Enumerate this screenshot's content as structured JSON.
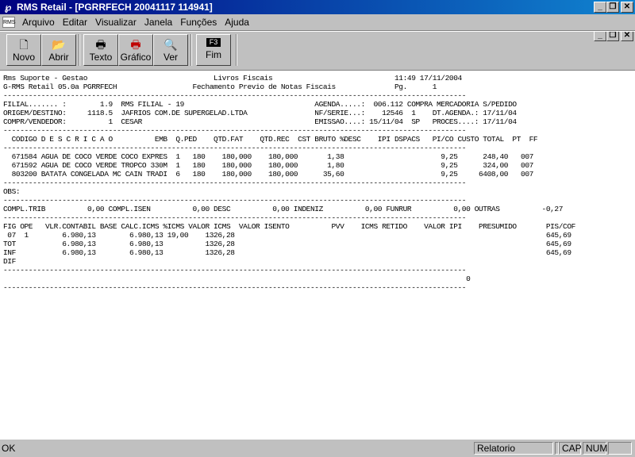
{
  "window": {
    "title": "RMS Retail - [PGRRFECH 20041117 114941]"
  },
  "menu": {
    "items": [
      "Arquivo",
      "Editar",
      "Visualizar",
      "Janela",
      "Funções",
      "Ajuda"
    ]
  },
  "toolbar": {
    "novo": "Novo",
    "abrir": "Abrir",
    "texto": "Texto",
    "grafico": "Gráfico",
    "ver": "Ver",
    "fim_key": "F3",
    "fim": "Fim"
  },
  "report": {
    "lines": [
      "Rms Suporte - Gestao                              Livros Fiscais                             11:49 17/11/2004",
      "G-RMS Retail 05.0a PGRRFECH                  Fechamento Previo de Notas Fiscais              Pg.      1",
      "--------------------------------------------------------------------------------------------------------------",
      "FILIAL....... :        1.9  RMS FILIAL - 19                               AGENDA.....:  006.112 COMPRA MERCADORIA S/PEDIDO",
      "ORIGEM/DESTINO:     1118.5  JAFRIOS COM.DE SUPERGELAD.LTDA                NF/SERIE...:    12546  1    DT.AGENDA.: 17/11/04",
      "COMPR/VENDEDOR:          1  CESAR                                         EMISSAO....: 15/11/04  SP   PROCES....: 17/11/04",
      "--------------------------------------------------------------------------------------------------------------",
      "  CODIGO D E S C R I C A O          EMB  Q.PED    QTD.FAT    QTD.REC  CST BRUTO %DESC    IPI DSPACS   PI/CO CUSTO TOTAL  PT  FF",
      "--------------------------------------------------------------------------------------------------------------",
      "  671584 AGUA DE COCO VERDE COCO EXPRES  1   180    180,000    180,000       1,38                       9,25      248,40   007",
      "  671592 AGUA DE COCO VERDE TROPCO 330M  1   180    180,000    180,000       1,80                       9,25      324,00   007",
      "  803200 BATATA CONGELADA MC CAIN TRADI  6   180    180,000    180,000      35,60                       9,25     6408,00   007",
      "--------------------------------------------------------------------------------------------------------------",
      "OBS:",
      "--------------------------------------------------------------------------------------------------------------",
      "COMPL.TRIB          0,00 COMPL.ISEN          0,00 DESC          0,00 INDENIZ          0,00 FUNRUR          0,00 OUTRAS          -0,27",
      "--------------------------------------------------------------------------------------------------------------",
      "FIG OPE   VLR.CONTABIL BASE CALC.ICMS %ICMS VALOR ICMS  VALOR ISENTO          PVV    ICMS RETIDO    VALOR IPI    PRESUMIDO       PIS/COF",
      " 07  1        6.980,13        6.980,13 19,00    1326,28                                                                          645,69",
      "TOT           6.980,13        6.980,13          1326,28                                                                          645,69",
      "INF           6.980,13        6.980,13          1326,28                                                                          645,69",
      "DIF",
      "--------------------------------------------------------------------------------------------------------------",
      "                                                                                                              0",
      "--------------------------------------------------------------------------------------------------------------"
    ]
  },
  "status": {
    "left": "OK",
    "panel1": "Relatorio",
    "panel2": "",
    "cap": "CAP",
    "num": "NUM",
    "panel5": ""
  }
}
